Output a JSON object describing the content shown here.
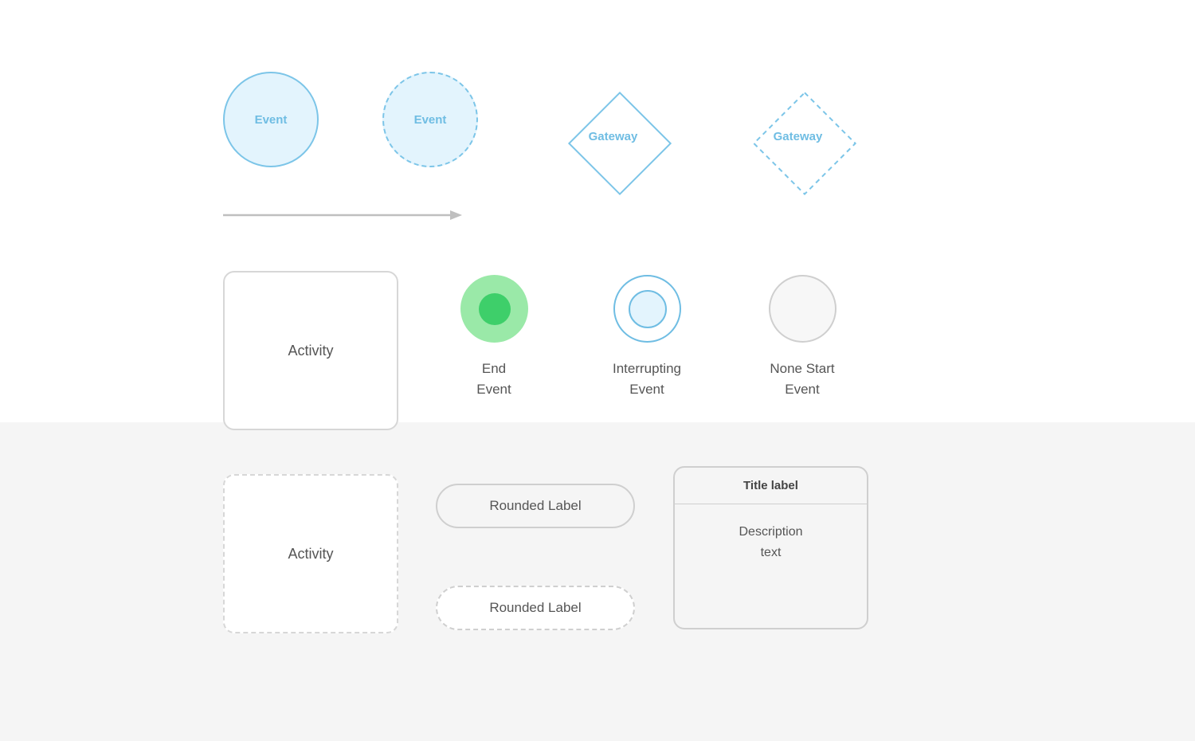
{
  "row1": {
    "event_solid_label": "Event",
    "event_dashed_label": "Event",
    "gateway_solid_label": "Gateway",
    "gateway_dashed_label": "Gateway"
  },
  "row2": {
    "activity_solid_label": "Activity",
    "end_event_caption": "End\nEvent",
    "interrupting_caption": "Interrupting\nEvent",
    "none_start_caption": "None Start\nEvent"
  },
  "row3": {
    "activity_dashed_label": "Activity",
    "rounded_label_solid": "Rounded Label",
    "rounded_label_dashed": "Rounded Label",
    "title_card": {
      "title": "Title label",
      "description": "Description\ntext"
    }
  },
  "colors": {
    "light_blue_fill": "#e3f4fd",
    "blue_stroke": "#7cc5e8",
    "blue_text": "#6fbde3",
    "green_fill": "#9ae9a8",
    "green_inner": "#3ecf6a",
    "gray_stroke": "#cfcfcf",
    "gray_text": "#555",
    "bottom_bg": "#f5f5f5"
  }
}
